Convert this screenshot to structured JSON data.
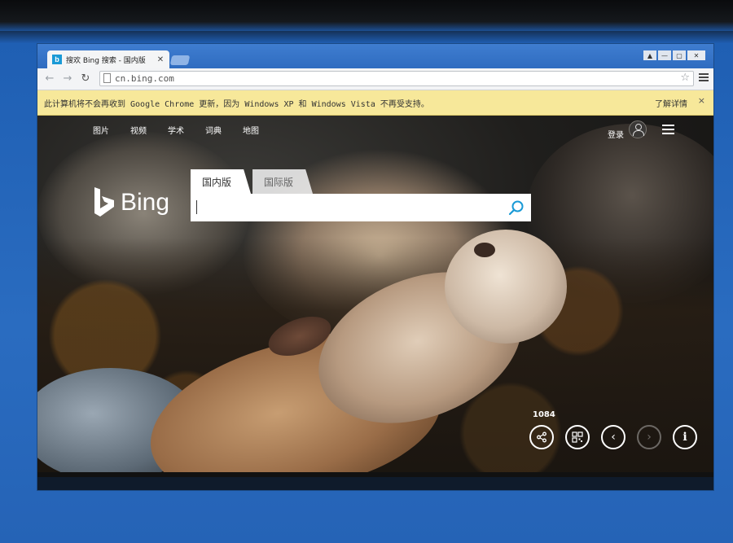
{
  "window": {
    "tab_title": "搜欢 Bing 搜索 - 国内版",
    "tab_favicon": "b",
    "controls": [
      "▲",
      "—",
      "▢",
      "✕"
    ]
  },
  "toolbar": {
    "url": "cn.bing.com"
  },
  "infobar": {
    "message": "此计算机将不会再收到 Google Chrome 更新，因为 Windows XP 和 Windows Vista 不再受支持。",
    "link": "了解详情",
    "close": "×"
  },
  "bing": {
    "nav": [
      "图片",
      "视频",
      "学术",
      "词典",
      "地图"
    ],
    "signin": "登录",
    "logo_text": "Bing",
    "search_tabs": [
      "国内版",
      "国际版"
    ],
    "search_placeholder": "",
    "counter": "1084"
  },
  "colors": {
    "titlebar": "#2f6cc0",
    "infobar": "#f7e89a",
    "bing_accent": "#1a9ad6"
  },
  "icons": [
    "back-icon",
    "forward-icon",
    "reload-icon",
    "page-icon",
    "star-icon",
    "menu-icon",
    "user-icon",
    "hamburger-icon",
    "search-icon",
    "share-icon",
    "qr-icon",
    "prev-icon",
    "next-icon",
    "info-icon"
  ]
}
